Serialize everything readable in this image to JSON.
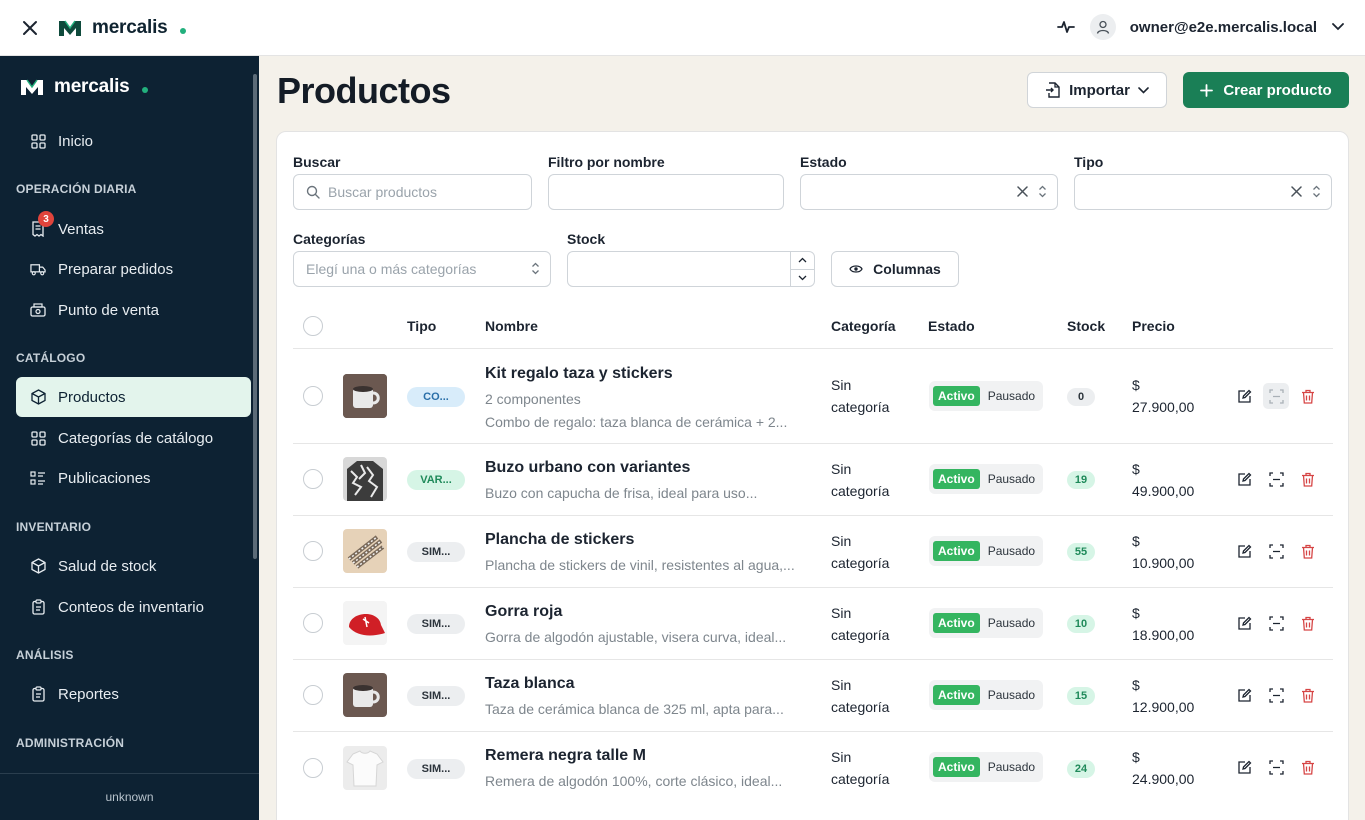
{
  "topbar": {
    "brand": "mercalis",
    "user_email": "owner@e2e.mercalis.local"
  },
  "sidebar": {
    "brand": "mercalis",
    "sections": {
      "operacion": "OPERACIÓN DIARIA",
      "catalogo": "CATÁLOGO",
      "inventario": "INVENTARIO",
      "analisis": "ANÁLISIS",
      "administracion": "ADMINISTRACIÓN"
    },
    "items": {
      "inicio": "Inicio",
      "ventas": "Ventas",
      "ventas_badge": "3",
      "preparar": "Preparar pedidos",
      "pos": "Punto de venta",
      "productos": "Productos",
      "categorias": "Categorías de catálogo",
      "publicaciones": "Publicaciones",
      "salud": "Salud de stock",
      "conteos": "Conteos de inventario",
      "reportes": "Reportes"
    },
    "footer": "unknown"
  },
  "page": {
    "title": "Productos",
    "import_label": "Importar",
    "create_label": "Crear producto"
  },
  "filters": {
    "buscar_label": "Buscar",
    "buscar_placeholder": "Buscar productos",
    "nombre_label": "Filtro por nombre",
    "estado_label": "Estado",
    "tipo_label": "Tipo",
    "categorias_label": "Categorías",
    "categorias_placeholder": "Elegí una o más categorías",
    "stock_label": "Stock",
    "columnas_label": "Columnas"
  },
  "table": {
    "headers": {
      "tipo": "Tipo",
      "nombre": "Nombre",
      "categoria": "Categoría",
      "estado": "Estado",
      "stock": "Stock",
      "precio": "Precio"
    },
    "state_active": "Activo",
    "state_paused": "Pausado",
    "rows": [
      {
        "tipo": "CO...",
        "name": "Kit regalo taza y stickers",
        "sub": "2 componentes",
        "desc": "Combo de regalo: taza blanca de cerámica + 2...",
        "cat1": "Sin",
        "cat2": "categoría",
        "stock": "0",
        "price1": "$",
        "price2": "27.900,00"
      },
      {
        "tipo": "VAR...",
        "name": "Buzo urbano con variantes",
        "desc": "Buzo con capucha de frisa, ideal para uso...",
        "cat1": "Sin",
        "cat2": "categoría",
        "stock": "19",
        "price1": "$",
        "price2": "49.900,00"
      },
      {
        "tipo": "SIM...",
        "name": "Plancha de stickers",
        "desc": "Plancha de stickers de vinil, resistentes al agua,...",
        "cat1": "Sin",
        "cat2": "categoría",
        "stock": "55",
        "price1": "$",
        "price2": "10.900,00"
      },
      {
        "tipo": "SIM...",
        "name": "Gorra roja",
        "desc": "Gorra de algodón ajustable, visera curva, ideal...",
        "cat1": "Sin",
        "cat2": "categoría",
        "stock": "10",
        "price1": "$",
        "price2": "18.900,00"
      },
      {
        "tipo": "SIM...",
        "name": "Taza blanca",
        "desc": "Taza de cerámica blanca de 325 ml, apta para...",
        "cat1": "Sin",
        "cat2": "categoría",
        "stock": "15",
        "price1": "$",
        "price2": "12.900,00"
      },
      {
        "tipo": "SIM...",
        "name": "Remera negra talle M",
        "desc": "Remera de algodón 100%, corte clásico, ideal...",
        "cat1": "Sin",
        "cat2": "categoría",
        "stock": "24",
        "price1": "$",
        "price2": "24.900,00"
      }
    ]
  },
  "colors": {
    "primary": "#1a7f56",
    "sidebar": "#0d2233",
    "active": "#34b560",
    "danger": "#d64545"
  }
}
